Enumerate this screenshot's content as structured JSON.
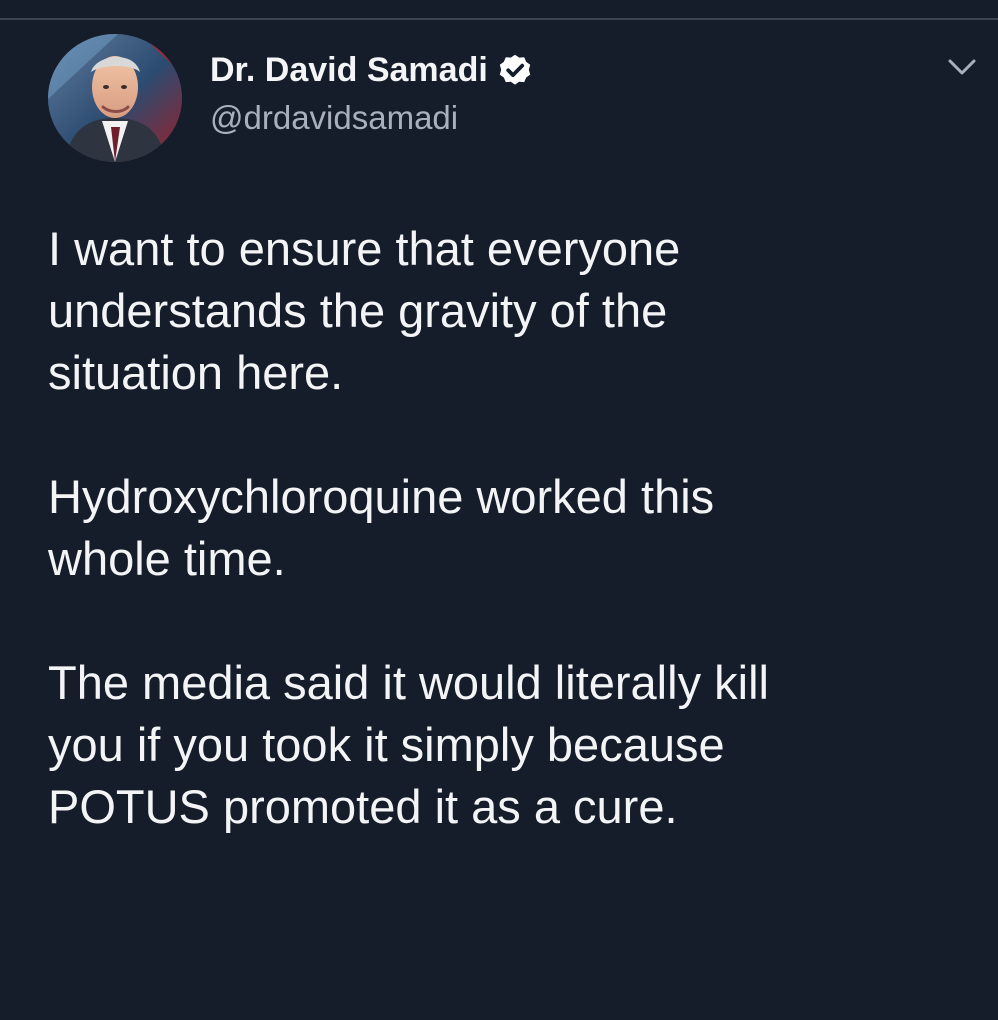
{
  "author": {
    "display_name": "Dr. David Samadi",
    "handle": "@drdavidsamadi",
    "verified": true,
    "avatar_icon": "profile-photo",
    "verified_icon": "verified-badge-icon",
    "menu_icon": "chevron-down-icon"
  },
  "tweet": {
    "paragraphs": [
      "I want to ensure that everyone\nunderstands the gravity of the\nsituation here.",
      "Hydroxychloroquine worked this\nwhole time.",
      "The media said it would literally kill\nyou if you took it simply because\nPOTUS promoted it as a cure."
    ]
  },
  "colors": {
    "background": "#151d2a",
    "primary_text": "#f2f4f6",
    "secondary_text": "#a8b0bb",
    "divider": "#3a4452",
    "verified_badge": "#ffffff"
  }
}
